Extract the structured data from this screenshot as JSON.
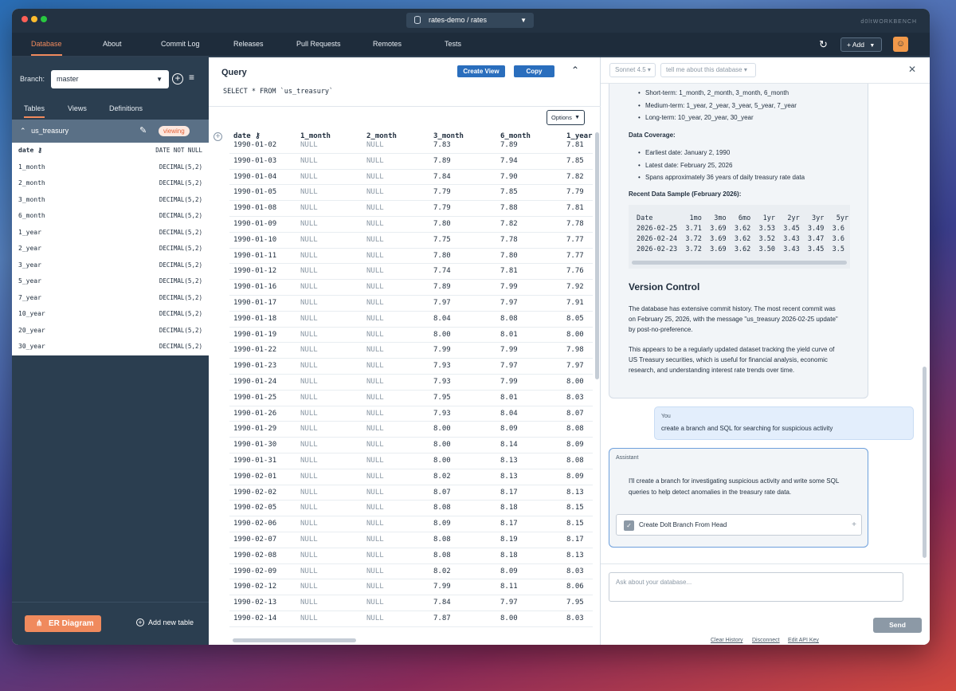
{
  "window": {
    "db_selector": "rates-demo / rates",
    "brand": "d0lt",
    "brand_sub": "WORKBENCH"
  },
  "nav": {
    "items": [
      "Database",
      "About",
      "Commit Log",
      "Releases",
      "Pull Requests",
      "Remotes",
      "Tests"
    ],
    "add_label": "+ Add"
  },
  "sidebar": {
    "branch_label": "Branch:",
    "branch_value": "master",
    "tabs": [
      "Tables",
      "Views",
      "Definitions"
    ],
    "table_name": "us_treasury",
    "viewing_badge": "viewing",
    "columns": [
      {
        "name": "date ⚷",
        "type": "DATE NOT NULL"
      },
      {
        "name": "1_month",
        "type": "DECIMAL(5,2)"
      },
      {
        "name": "2_month",
        "type": "DECIMAL(5,2)"
      },
      {
        "name": "3_month",
        "type": "DECIMAL(5,2)"
      },
      {
        "name": "6_month",
        "type": "DECIMAL(5,2)"
      },
      {
        "name": "1_year",
        "type": "DECIMAL(5,2)"
      },
      {
        "name": "2_year",
        "type": "DECIMAL(5,2)"
      },
      {
        "name": "3_year",
        "type": "DECIMAL(5,2)"
      },
      {
        "name": "5_year",
        "type": "DECIMAL(5,2)"
      },
      {
        "name": "7_year",
        "type": "DECIMAL(5,2)"
      },
      {
        "name": "10_year",
        "type": "DECIMAL(5,2)"
      },
      {
        "name": "20_year",
        "type": "DECIMAL(5,2)"
      },
      {
        "name": "30_year",
        "type": "DECIMAL(5,2)"
      }
    ],
    "er_button": "ER Diagram",
    "add_table": "Add new table"
  },
  "query": {
    "title": "Query",
    "create_view": "Create View",
    "copy": "Copy",
    "sql": "SELECT * FROM `us_treasury`",
    "options": "Options"
  },
  "grid": {
    "headers": [
      "date ⚷",
      "1_month",
      "2_month",
      "3_month",
      "6_month",
      "1_year"
    ],
    "rows": [
      [
        "1990-01-02",
        "NULL",
        "NULL",
        "7.83",
        "7.89",
        "7.81"
      ],
      [
        "1990-01-03",
        "NULL",
        "NULL",
        "7.89",
        "7.94",
        "7.85"
      ],
      [
        "1990-01-04",
        "NULL",
        "NULL",
        "7.84",
        "7.90",
        "7.82"
      ],
      [
        "1990-01-05",
        "NULL",
        "NULL",
        "7.79",
        "7.85",
        "7.79"
      ],
      [
        "1990-01-08",
        "NULL",
        "NULL",
        "7.79",
        "7.88",
        "7.81"
      ],
      [
        "1990-01-09",
        "NULL",
        "NULL",
        "7.80",
        "7.82",
        "7.78"
      ],
      [
        "1990-01-10",
        "NULL",
        "NULL",
        "7.75",
        "7.78",
        "7.77"
      ],
      [
        "1990-01-11",
        "NULL",
        "NULL",
        "7.80",
        "7.80",
        "7.77"
      ],
      [
        "1990-01-12",
        "NULL",
        "NULL",
        "7.74",
        "7.81",
        "7.76"
      ],
      [
        "1990-01-16",
        "NULL",
        "NULL",
        "7.89",
        "7.99",
        "7.92"
      ],
      [
        "1990-01-17",
        "NULL",
        "NULL",
        "7.97",
        "7.97",
        "7.91"
      ],
      [
        "1990-01-18",
        "NULL",
        "NULL",
        "8.04",
        "8.08",
        "8.05"
      ],
      [
        "1990-01-19",
        "NULL",
        "NULL",
        "8.00",
        "8.01",
        "8.00"
      ],
      [
        "1990-01-22",
        "NULL",
        "NULL",
        "7.99",
        "7.99",
        "7.98"
      ],
      [
        "1990-01-23",
        "NULL",
        "NULL",
        "7.93",
        "7.97",
        "7.97"
      ],
      [
        "1990-01-24",
        "NULL",
        "NULL",
        "7.93",
        "7.99",
        "8.00"
      ],
      [
        "1990-01-25",
        "NULL",
        "NULL",
        "7.95",
        "8.01",
        "8.03"
      ],
      [
        "1990-01-26",
        "NULL",
        "NULL",
        "7.93",
        "8.04",
        "8.07"
      ],
      [
        "1990-01-29",
        "NULL",
        "NULL",
        "8.00",
        "8.09",
        "8.08"
      ],
      [
        "1990-01-30",
        "NULL",
        "NULL",
        "8.00",
        "8.14",
        "8.09"
      ],
      [
        "1990-01-31",
        "NULL",
        "NULL",
        "8.00",
        "8.13",
        "8.08"
      ],
      [
        "1990-02-01",
        "NULL",
        "NULL",
        "8.02",
        "8.13",
        "8.09"
      ],
      [
        "1990-02-02",
        "NULL",
        "NULL",
        "8.07",
        "8.17",
        "8.13"
      ],
      [
        "1990-02-05",
        "NULL",
        "NULL",
        "8.08",
        "8.18",
        "8.15"
      ],
      [
        "1990-02-06",
        "NULL",
        "NULL",
        "8.09",
        "8.17",
        "8.15"
      ],
      [
        "1990-02-07",
        "NULL",
        "NULL",
        "8.08",
        "8.19",
        "8.17"
      ],
      [
        "1990-02-08",
        "NULL",
        "NULL",
        "8.08",
        "8.18",
        "8.13"
      ],
      [
        "1990-02-09",
        "NULL",
        "NULL",
        "8.02",
        "8.09",
        "8.03"
      ],
      [
        "1990-02-12",
        "NULL",
        "NULL",
        "7.99",
        "8.11",
        "8.06"
      ],
      [
        "1990-02-13",
        "NULL",
        "NULL",
        "7.84",
        "7.97",
        "7.95"
      ],
      [
        "1990-02-14",
        "NULL",
        "NULL",
        "7.87",
        "8.00",
        "8.03"
      ]
    ]
  },
  "chat": {
    "model": "Sonnet 4.5",
    "prompt_placeholder": "tell me about this database",
    "assistant1": {
      "short_term": "Short-term: 1_month, 2_month, 3_month, 6_month",
      "medium_term": "Medium-term: 1_year, 2_year, 3_year, 5_year, 7_year",
      "long_term": "Long-term: 10_year, 20_year, 30_year",
      "coverage_heading": "Data Coverage:",
      "coverage": [
        "Earliest date: January 2, 1990",
        "Latest date: February 25, 2026",
        "Spans approximately 36 years of daily treasury rate data"
      ],
      "sample_heading": "Recent Data Sample (February 2026):",
      "sample_lines": [
        "Date         1mo   3mo   6mo   1yr   2yr   3yr   5yr",
        "2026-02-25  3.71  3.69  3.62  3.53  3.45  3.49  3.6",
        "2026-02-24  3.72  3.69  3.62  3.52  3.43  3.47  3.6",
        "2026-02-23  3.72  3.69  3.62  3.50  3.43  3.45  3.5"
      ],
      "vc_heading": "Version Control",
      "vc_p1_l1": "The database has extensive commit history. The most recent commit was",
      "vc_p1_l2": "on February 25, 2026, with the message \"us_treasury 2026-02-25 update\"",
      "vc_p1_l3": "by post-no-preference.",
      "vc_p2_l1": "This appears to be a regularly updated dataset tracking the yield curve of",
      "vc_p2_l2": "US Treasury securities, which is useful for financial analysis, economic",
      "vc_p2_l3": "research, and understanding interest rate trends over time."
    },
    "user": {
      "label": "You",
      "text": "create a branch and SQL for searching for suspicious activity"
    },
    "assistant2": {
      "label": "Assistant",
      "line1": "I'll create a branch for investigating suspicious activity and write some SQL",
      "line2": "queries to help detect anomalies in the treasury rate data.",
      "tool_label": "Create Dolt Branch From Head"
    },
    "input_placeholder": "Ask about your database...",
    "send": "Send",
    "links": [
      "Clear History",
      "Disconnect",
      "Edit API Key"
    ]
  }
}
